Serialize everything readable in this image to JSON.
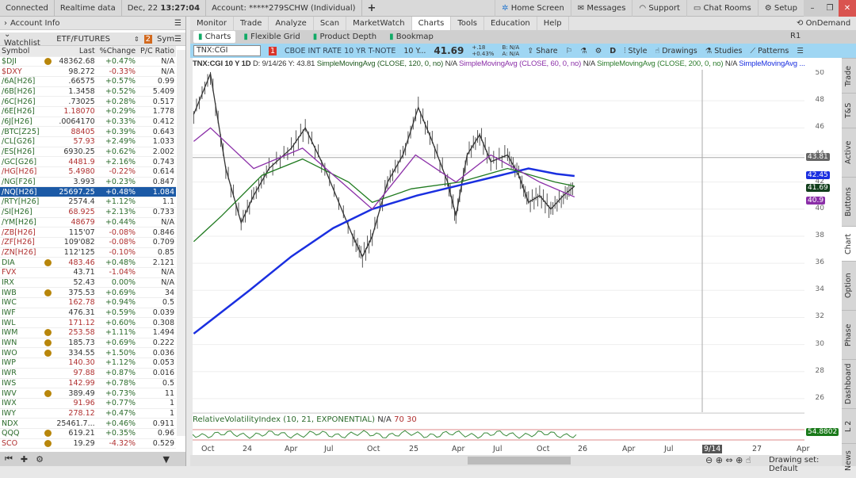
{
  "topbar": {
    "connected": "Connected",
    "realtime": "Realtime data",
    "date": "Dec, 22",
    "time": "13:27:04",
    "account": "Account: *****279SCHW (Individual)",
    "plus": "+",
    "home": "Home Screen",
    "messages": "Messages",
    "support": "Support",
    "chat": "Chat Rooms",
    "setup": "Setup"
  },
  "left": {
    "account_info": "Account Info",
    "watchlist": "Watchlist",
    "list_name": "ETF/FUTURES",
    "sym_col": "Sym",
    "headers": [
      "Symbol",
      "Last",
      "%Change",
      "P/C Ratio"
    ],
    "rows": [
      [
        "$DJI",
        "48362.68",
        "+0.47%",
        "N/A",
        "g",
        1,
        0,
        0
      ],
      [
        "$DXY",
        "98.272",
        "-0.33%",
        "N/A",
        "r",
        0,
        0,
        1
      ],
      [
        "/6A[H26]",
        ".66575",
        "+0.57%",
        "0.99",
        "g",
        0,
        0,
        0
      ],
      [
        "/6B[H26]",
        "1.3458",
        "+0.52%",
        "5.409",
        "g",
        0,
        0,
        0
      ],
      [
        "/6C[H26]",
        ".73025",
        "+0.28%",
        "0.517",
        "g",
        0,
        0,
        0
      ],
      [
        "/6E[H26]",
        "1.18070",
        "+0.29%",
        "1.778",
        "g",
        0,
        1,
        0
      ],
      [
        "/6J[H26]",
        ".0064170",
        "+0.33%",
        "0.412",
        "g",
        0,
        0,
        0
      ],
      [
        "/BTC[Z25]",
        "88405",
        "+0.39%",
        "0.643",
        "g",
        0,
        1,
        0
      ],
      [
        "/CL[G26]",
        "57.93",
        "+2.49%",
        "1.033",
        "g",
        0,
        1,
        0
      ],
      [
        "/ES[H26]",
        "6930.25",
        "+0.62%",
        "2.002",
        "g",
        0,
        0,
        0
      ],
      [
        "/GC[G26]",
        "4481.9",
        "+2.16%",
        "0.743",
        "g",
        0,
        1,
        0
      ],
      [
        "/HG[H26]",
        "5.4980",
        "-0.22%",
        "0.614",
        "r",
        0,
        1,
        1
      ],
      [
        "/NG[F26]",
        "3.993",
        "+0.23%",
        "0.847",
        "g",
        0,
        0,
        0
      ],
      [
        "/NQ[H26]",
        "25697.25",
        "+0.48%",
        "1.084",
        "s",
        0,
        0,
        0
      ],
      [
        "/RTY[H26]",
        "2574.4",
        "+1.12%",
        "1.1",
        "g",
        0,
        0,
        0
      ],
      [
        "/SI[H26]",
        "68.925",
        "+2.13%",
        "0.733",
        "g",
        0,
        1,
        0
      ],
      [
        "/YM[H26]",
        "48679",
        "+0.44%",
        "N/A",
        "g",
        0,
        1,
        0
      ],
      [
        "/ZB[H26]",
        "115'07",
        "-0.08%",
        "0.846",
        "r",
        0,
        0,
        1
      ],
      [
        "/ZF[H26]",
        "109'082",
        "-0.08%",
        "0.709",
        "r",
        0,
        0,
        1
      ],
      [
        "/ZN[H26]",
        "112'125",
        "-0.10%",
        "0.85",
        "r",
        0,
        0,
        1
      ],
      [
        "DIA",
        "483.46",
        "+0.48%",
        "2.121",
        "g",
        1,
        1,
        0
      ],
      [
        "FVX",
        "43.71",
        "-1.04%",
        "N/A",
        "r",
        0,
        0,
        1
      ],
      [
        "IRX",
        "52.43",
        "0.00%",
        "N/A",
        "g",
        0,
        0,
        0
      ],
      [
        "IWB",
        "375.53",
        "+0.69%",
        "34",
        "g",
        1,
        0,
        0
      ],
      [
        "IWC",
        "162.78",
        "+0.94%",
        "0.5",
        "g",
        0,
        1,
        0
      ],
      [
        "IWF",
        "476.31",
        "+0.59%",
        "0.039",
        "g",
        0,
        0,
        0
      ],
      [
        "IWL",
        "171.12",
        "+0.60%",
        "0.308",
        "g",
        0,
        1,
        0
      ],
      [
        "IWM",
        "253.58",
        "+1.11%",
        "1.494",
        "g",
        1,
        1,
        0
      ],
      [
        "IWN",
        "185.73",
        "+0.69%",
        "0.222",
        "g",
        1,
        0,
        0
      ],
      [
        "IWO",
        "334.55",
        "+1.50%",
        "0.036",
        "g",
        1,
        0,
        0
      ],
      [
        "IWP",
        "140.30",
        "+1.12%",
        "0.053",
        "g",
        0,
        1,
        0
      ],
      [
        "IWR",
        "97.88",
        "+0.87%",
        "0.016",
        "g",
        0,
        1,
        0
      ],
      [
        "IWS",
        "142.99",
        "+0.78%",
        "0.5",
        "g",
        0,
        1,
        0
      ],
      [
        "IWV",
        "389.49",
        "+0.73%",
        "11",
        "g",
        1,
        0,
        0
      ],
      [
        "IWX",
        "91.96",
        "+0.77%",
        "1",
        "g",
        0,
        1,
        0
      ],
      [
        "IWY",
        "278.12",
        "+0.47%",
        "1",
        "g",
        0,
        1,
        0
      ],
      [
        "NDX",
        "25461.7...",
        "+0.46%",
        "0.911",
        "g",
        0,
        0,
        0
      ],
      [
        "QQQ",
        "619.21",
        "+0.35%",
        "0.96",
        "g",
        1,
        0,
        0
      ],
      [
        "SCO",
        "19.29",
        "-4.32%",
        "0.529",
        "r",
        1,
        0,
        1
      ]
    ]
  },
  "menu": {
    "tabs": [
      "Monitor",
      "Trade",
      "Analyze",
      "Scan",
      "MarketWatch",
      "Charts",
      "Tools",
      "Education",
      "Help"
    ],
    "active": "Charts",
    "ondemand": "OnDemand"
  },
  "sub": {
    "items": [
      "Charts",
      "Flexible Grid",
      "Product Depth",
      "Bookmap"
    ],
    "r1": "R1"
  },
  "toolbar": {
    "symbol": "TNX:CGI",
    "link": "1",
    "description": "CBOE INT RATE 10 YR T-NOTE",
    "desc_short": "10 Y...",
    "price": "41.69",
    "chg": "+.18",
    "chg_pct": "+0.43%",
    "bid": "B: N/A",
    "ask": "A: N/A",
    "share": "Share",
    "period": "D",
    "style": "Style",
    "drawings": "Drawings",
    "studies": "Studies",
    "patterns": "Patterns"
  },
  "studies": {
    "head": "TNX:CGI 10 Y 1D",
    "d": "D: 9/14/26",
    "y": "Y: 43.81",
    "s1": "SimpleMovingAvg (CLOSE, 120, 0, no)",
    "s1v": "N/A",
    "s2": "SimpleMovingAvg (CLOSE, 60, 0, no)",
    "s2v": "N/A",
    "s3": "SimpleMovingAvg (CLOSE, 200, 0, no)",
    "s3v": "N/A",
    "s4": "SimpleMovingAvg ..."
  },
  "axis": {
    "ticks": [
      "50",
      "48",
      "46",
      "44",
      "42",
      "40",
      "38",
      "36",
      "34",
      "32",
      "30",
      "28",
      "26"
    ],
    "cursor": "43.81",
    "ma200": "42.45",
    "last": "41.69",
    "ma60": "40.9",
    "rsi": "54.8802"
  },
  "rsi": {
    "label": "RelativeVolatilityIndex (10, 21, EXPONENTIAL)",
    "na": "N/A",
    "hi": "70",
    "lo": "30"
  },
  "xaxis": {
    "labels": [
      "Oct",
      "24",
      "Apr",
      "Jul",
      "Oct",
      "25",
      "Apr",
      "Jul",
      "Oct",
      "26",
      "Apr",
      "Jul",
      "27",
      "Apr"
    ],
    "cursor": "9/14"
  },
  "right_tabs": [
    "Trade",
    "T&S",
    "Active Trader",
    "Buttons",
    "Chart",
    "Option Chain",
    "Phase Scores",
    "Dashboard",
    "L 2",
    "News"
  ],
  "bottom": {
    "drawing_set": "Drawing set: Default"
  },
  "chart_data": {
    "type": "line",
    "ylim": [
      26,
      50
    ],
    "x_unit": "months since Oct 2023",
    "series": [
      {
        "name": "TNX close",
        "color": "#333333",
        "points": [
          [
            -1,
            47
          ],
          [
            0.2,
            50
          ],
          [
            1.3,
            43
          ],
          [
            2.4,
            39
          ],
          [
            3.3,
            41
          ],
          [
            4.4,
            43
          ],
          [
            6,
            44.5
          ],
          [
            7,
            46
          ],
          [
            8.4,
            43
          ],
          [
            10.4,
            38
          ],
          [
            11.1,
            36.5
          ],
          [
            11.8,
            38
          ],
          [
            12.9,
            42
          ],
          [
            14,
            44
          ],
          [
            15.1,
            47.5
          ],
          [
            16.1,
            45
          ],
          [
            17.2,
            42
          ],
          [
            17.8,
            39.5
          ],
          [
            18.6,
            44
          ],
          [
            19.5,
            45.5
          ],
          [
            20.3,
            43.5
          ],
          [
            21.5,
            44
          ],
          [
            22.3,
            42.5
          ],
          [
            23,
            40.5
          ],
          [
            23.8,
            41
          ],
          [
            24.6,
            40
          ],
          [
            25.5,
            41
          ],
          [
            26.3,
            41.69
          ]
        ]
      },
      {
        "name": "SMA 200",
        "color": "#1a2fe0",
        "points": [
          [
            -1,
            30.8
          ],
          [
            3,
            34
          ],
          [
            6,
            36.5
          ],
          [
            9,
            38.6
          ],
          [
            11.8,
            40
          ],
          [
            15,
            41
          ],
          [
            17,
            41.5
          ],
          [
            21,
            42.5
          ],
          [
            23,
            43
          ],
          [
            25,
            42.6
          ],
          [
            26.3,
            42.45
          ]
        ]
      },
      {
        "name": "SMA 120",
        "color": "#1f7a1f",
        "points": [
          [
            -1,
            37.6
          ],
          [
            1,
            39.5
          ],
          [
            3.9,
            42.5
          ],
          [
            6.8,
            43.7
          ],
          [
            10.1,
            42
          ],
          [
            11.8,
            40.5
          ],
          [
            14.6,
            41.5
          ],
          [
            18.1,
            42
          ],
          [
            21.5,
            43
          ],
          [
            24.9,
            42
          ],
          [
            26.3,
            41.7
          ]
        ]
      },
      {
        "name": "SMA 60",
        "color": "#8b2fa8",
        "points": [
          [
            -1,
            45
          ],
          [
            0.2,
            46
          ],
          [
            3.3,
            43
          ],
          [
            6.8,
            44.5
          ],
          [
            10.7,
            41
          ],
          [
            11.8,
            40
          ],
          [
            14.9,
            44
          ],
          [
            17.8,
            42
          ],
          [
            20.3,
            44
          ],
          [
            23.8,
            42
          ],
          [
            26.3,
            40.9
          ]
        ]
      }
    ]
  }
}
